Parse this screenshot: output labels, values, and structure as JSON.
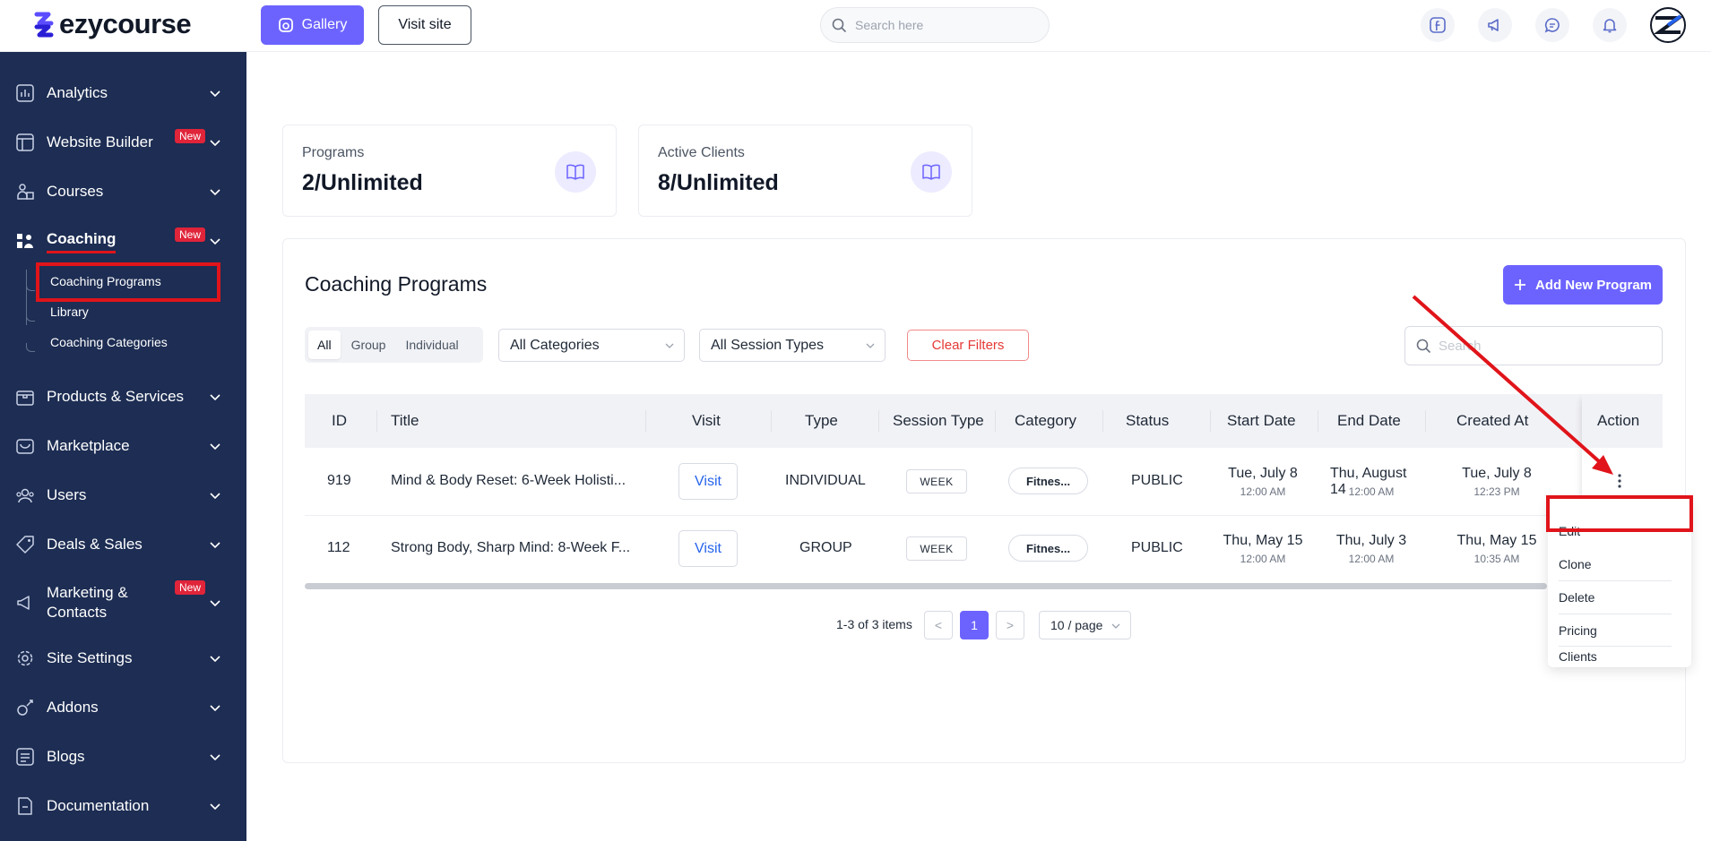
{
  "app": {
    "brand": "ezycourse"
  },
  "topbar": {
    "gallery_label": "Gallery",
    "visit_site_label": "Visit site",
    "search_placeholder": "Search here"
  },
  "sidebar": {
    "items": [
      {
        "label": "Analytics"
      },
      {
        "label": "Website Builder",
        "badge": "New"
      },
      {
        "label": "Courses"
      },
      {
        "label": "Coaching",
        "badge": "New"
      },
      {
        "label": "Products & Services"
      },
      {
        "label": "Marketplace"
      },
      {
        "label": "Users"
      },
      {
        "label": "Deals & Sales"
      },
      {
        "label": "Marketing & Contacts",
        "badge": "New"
      },
      {
        "label": "Site Settings"
      },
      {
        "label": "Addons"
      },
      {
        "label": "Blogs"
      },
      {
        "label": "Documentation"
      }
    ],
    "coaching_sub": [
      "Coaching Programs",
      "Library",
      "Coaching Categories"
    ]
  },
  "stats": [
    {
      "label": "Programs",
      "value": "2/Unlimited"
    },
    {
      "label": "Active Clients",
      "value": "8/Unlimited"
    }
  ],
  "main": {
    "title": "Coaching Programs",
    "add_button": "Add New Program",
    "filters": {
      "segments": [
        "All",
        "Group",
        "Individual"
      ],
      "category_select": "All Categories",
      "session_select": "All Session Types",
      "clear_label": "Clear Filters",
      "search_placeholder": "Search"
    },
    "table": {
      "columns": [
        "ID",
        "Title",
        "Visit",
        "Type",
        "Session Type",
        "Category",
        "Status",
        "Start Date",
        "End Date",
        "Created At",
        "Action"
      ],
      "rows": [
        {
          "id": "919",
          "title": "Mind & Body Reset: 6-Week Holisti...",
          "visit": "Visit",
          "type": "INDIVIDUAL",
          "session_type": "WEEK",
          "category": "Fitnes...",
          "status": "PUBLIC",
          "start_date": "Tue, July 8",
          "start_time": "12:00 AM",
          "end_date": "Thu, August 14",
          "end_time": "12:00 AM",
          "created_date": "Tue, July 8",
          "created_time": "12:23 PM"
        },
        {
          "id": "112",
          "title": "Strong Body, Sharp Mind: 8-Week F...",
          "visit": "Visit",
          "type": "GROUP",
          "session_type": "WEEK",
          "category": "Fitnes...",
          "status": "PUBLIC",
          "start_date": "Thu, May 15",
          "start_time": "12:00 AM",
          "end_date": "Thu, July 3",
          "end_time": "12:00 AM",
          "created_date": "Thu, May 15",
          "created_time": "10:35 AM"
        }
      ]
    },
    "pagination": {
      "summary": "1-3 of 3 items",
      "prev": "<",
      "current": "1",
      "next": ">",
      "page_size": "10 / page"
    },
    "action_menu": [
      "Edit",
      "Clone",
      "Delete",
      "Pricing",
      "Clients"
    ]
  },
  "colors": {
    "sidebar": "#1d2d53",
    "primary": "#6c63ff",
    "annotation": "#e0141a"
  }
}
